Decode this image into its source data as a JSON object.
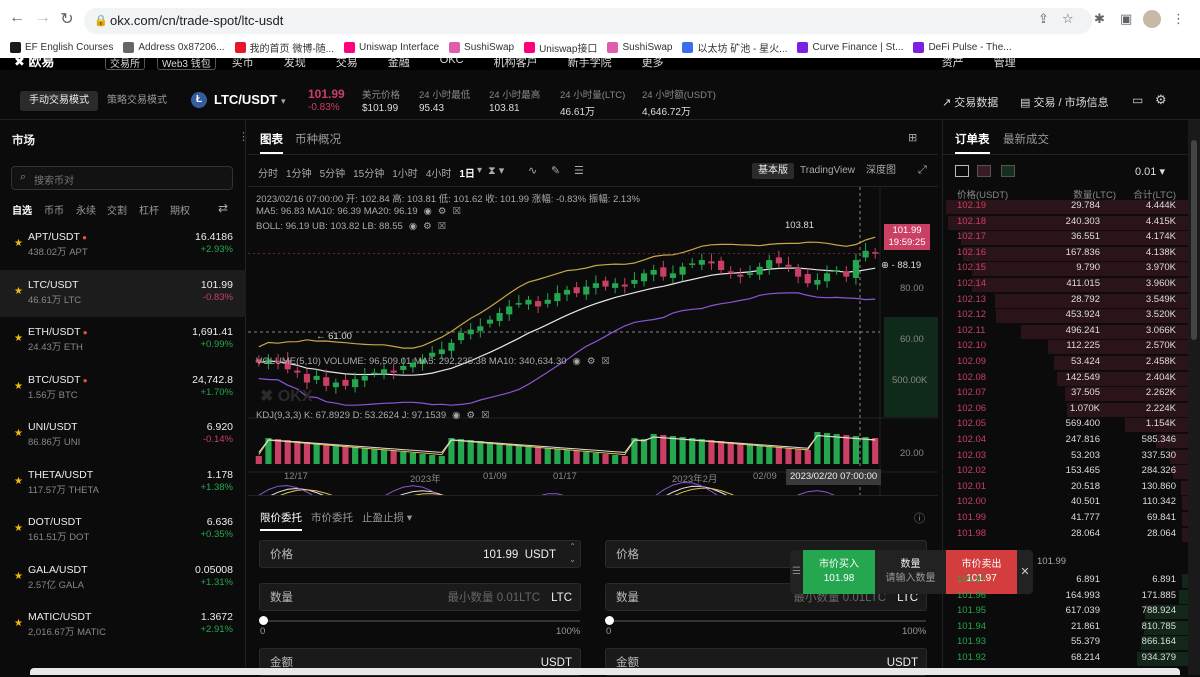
{
  "browser": {
    "url": "okx.com/cn/trade-spot/ltc-usdt",
    "bookmarks": [
      {
        "label": "EF English Courses",
        "color": "#1a1a1a"
      },
      {
        "label": "Address 0x87206...",
        "color": "#666"
      },
      {
        "label": "我的首页 微博-随...",
        "color": "#e6162d"
      },
      {
        "label": "Uniswap Interface",
        "color": "#ff007a"
      },
      {
        "label": "SushiSwap",
        "color": "#e05dab"
      },
      {
        "label": "Uniswap接口",
        "color": "#ff007a"
      },
      {
        "label": "SushiSwap",
        "color": "#e05dab"
      },
      {
        "label": "以太坊 矿池 - 星火...",
        "color": "#3a6df0"
      },
      {
        "label": "Curve Finance | St...",
        "color": "#7b1fe0"
      },
      {
        "label": "DeFi Pulse - The...",
        "color": "#7b1fe0"
      }
    ]
  },
  "topnav": {
    "items": [
      "交易所",
      "Web3 钱包",
      "买币",
      "发现",
      "交易",
      "金融",
      "OKC",
      "机构客户",
      "新手学院",
      "更多",
      "资产",
      "管理"
    ]
  },
  "ticker": {
    "mode_manual": "手动交易模式",
    "mode_strategy": "策略交易模式",
    "pair": "LTC/USDT",
    "price": "101.99",
    "change": "-0.83%",
    "stats": [
      {
        "label": "美元价格",
        "value": "$101.99"
      },
      {
        "label": "24 小时最低",
        "value": "95.43"
      },
      {
        "label": "24 小时最高",
        "value": "103.81"
      },
      {
        "label": "24 小时量(LTC)",
        "value": "46.61万"
      },
      {
        "label": "24 小时额(USDT)",
        "value": "4,646.72万"
      }
    ],
    "trade_data": "交易数据",
    "trade_info": "交易 / 市场信息"
  },
  "market": {
    "title": "市场",
    "search_placeholder": "搜索币对",
    "tabs": [
      "自选",
      "币币",
      "永续",
      "交割",
      "杠杆",
      "期权"
    ],
    "rows": [
      {
        "pair": "APT/USDT",
        "vol": "438.02万 APT",
        "price": "16.4186",
        "change": "+2.93%",
        "dir": "up",
        "fire": true
      },
      {
        "pair": "LTC/USDT",
        "vol": "46.61万 LTC",
        "price": "101.99",
        "change": "-0.83%",
        "dir": "down",
        "fire": false
      },
      {
        "pair": "ETH/USDT",
        "vol": "24.43万 ETH",
        "price": "1,691.41",
        "change": "+0.99%",
        "dir": "up",
        "fire": true
      },
      {
        "pair": "BTC/USDT",
        "vol": "1.56万 BTC",
        "price": "24,742.8",
        "change": "+1.70%",
        "dir": "up",
        "fire": true
      },
      {
        "pair": "UNI/USDT",
        "vol": "86.86万 UNI",
        "price": "6.920",
        "change": "-0.14%",
        "dir": "down",
        "fire": false
      },
      {
        "pair": "THETA/USDT",
        "vol": "117.57万 THETA",
        "price": "1.178",
        "change": "+1.38%",
        "dir": "up",
        "fire": false
      },
      {
        "pair": "DOT/USDT",
        "vol": "161.51万 DOT",
        "price": "6.636",
        "change": "+0.35%",
        "dir": "up",
        "fire": false
      },
      {
        "pair": "GALA/USDT",
        "vol": "2.57亿 GALA",
        "price": "0.05008",
        "change": "+1.31%",
        "dir": "up",
        "fire": false
      },
      {
        "pair": "MATIC/USDT",
        "vol": "2,016.67万 MATIC",
        "price": "1.3672",
        "change": "+2.91%",
        "dir": "up",
        "fire": false
      }
    ]
  },
  "chart": {
    "tab_chart": "图表",
    "tab_overview": "币种概况",
    "intervals": [
      "分时",
      "1分钟",
      "5分钟",
      "15分钟",
      "1小时",
      "4小时",
      "1日"
    ],
    "active_interval": "1日",
    "view_basic": "基本版",
    "view_tv": "TradingView",
    "view_depth": "深度图",
    "ohlc_line": "2023/02/16 07:00:00  开: 102.84  高: 103.81  低: 101.62  收: 101.99  涨幅: -0.83%  振幅: 2.13%",
    "ma_line": "MA5: 96.83  MA10: 96.39  MA20: 96.19",
    "boll_line": "BOLL: 96.19  UB: 103.82  LB: 88.55",
    "vol_line": "VOLUME(5,10)  VOLUME: 96,509.01  MA5: 292,235.38  MA10: 340,634.30",
    "kdj_line": "KDJ(9,3,3)  K: 67.8929  D: 53.2624  J: 97.1539",
    "price_tag": "101.99",
    "countdown": "19:59:25",
    "crosshair_price": "88.19",
    "high_label": "103.81",
    "low_label": "61.00",
    "y_ticks": [
      "80.00",
      "60.00"
    ],
    "vol_tick": "500.00K",
    "kdj_tick": "20.00",
    "x_ticks": [
      "12/17",
      "2023年",
      "01/09",
      "01/17",
      "2023年2月",
      "02/09"
    ],
    "crosshair_time": "2023/02/20 07:00:00"
  },
  "chart_data": {
    "type": "candlestick",
    "title": "LTC/USDT 1日",
    "ylim": [
      55,
      110
    ],
    "close": [
      69,
      70,
      69,
      67,
      66,
      63,
      65,
      62,
      63,
      62,
      64,
      65,
      66,
      67,
      66,
      68,
      69,
      70,
      72,
      73,
      75,
      78,
      79,
      80,
      82,
      84,
      86,
      87,
      88,
      86,
      88,
      90,
      91,
      90,
      92,
      93,
      92,
      93,
      92,
      94,
      96,
      97,
      95,
      96,
      98,
      99,
      100,
      99,
      97,
      96,
      95,
      96,
      98,
      100,
      99,
      98,
      95,
      93,
      94,
      96,
      97,
      95,
      100,
      102.8,
      101.99
    ],
    "volume_ma_label": "VOLUME(5,10)"
  },
  "trade": {
    "tabs": [
      "限价委托",
      "市价委托",
      "止盈止损"
    ],
    "price_label": "价格",
    "price_value": "101.99",
    "unit_usdt": "USDT",
    "qty_label": "数量",
    "qty_placeholder": "最小数量 0.01LTC",
    "unit_ltc": "LTC",
    "slider_min": "0",
    "slider_max": "100%",
    "amount_label": "金额"
  },
  "popup": {
    "buy": "市价买入",
    "buy_price": "101.98",
    "qty": "数量",
    "qty_hint": "请输入数量",
    "sell": "市价卖出",
    "sell_price": "101.97"
  },
  "orderbook": {
    "tab_book": "订单表",
    "tab_trades": "最新成交",
    "precision": "0.01",
    "headers": [
      "价格(USDT)",
      "数量(LTC)",
      "合计(LTC)"
    ],
    "asks": [
      [
        "102.19",
        "29.784",
        "4.444K"
      ],
      [
        "102.18",
        "240.303",
        "4.415K"
      ],
      [
        "102.17",
        "36.551",
        "4.174K"
      ],
      [
        "102.16",
        "167.836",
        "4.138K"
      ],
      [
        "102.15",
        "9.790",
        "3.970K"
      ],
      [
        "102.14",
        "411.015",
        "3.960K"
      ],
      [
        "102.13",
        "28.792",
        "3.549K"
      ],
      [
        "102.12",
        "453.924",
        "3.520K"
      ],
      [
        "102.11",
        "496.241",
        "3.066K"
      ],
      [
        "102.10",
        "112.225",
        "2.570K"
      ],
      [
        "102.09",
        "53.424",
        "2.458K"
      ],
      [
        "102.08",
        "142.549",
        "2.404K"
      ],
      [
        "102.07",
        "37.505",
        "2.262K"
      ],
      [
        "102.06",
        "1.070K",
        "2.224K"
      ],
      [
        "102.05",
        "569.400",
        "1.154K"
      ],
      [
        "102.04",
        "247.816",
        "585.346"
      ],
      [
        "102.03",
        "53.203",
        "337.530"
      ],
      [
        "102.02",
        "153.465",
        "284.326"
      ],
      [
        "102.01",
        "20.518",
        "130.860"
      ],
      [
        "102.00",
        "40.501",
        "110.342"
      ],
      [
        "101.99",
        "41.777",
        "69.841"
      ],
      [
        "101.98",
        "28.064",
        "28.064"
      ]
    ],
    "mid_price": "101.99",
    "bids": [
      [
        "101.97",
        "6.891",
        "6.891"
      ],
      [
        "101.96",
        "164.993",
        "171.885"
      ],
      [
        "101.95",
        "617.039",
        "788.924"
      ],
      [
        "101.94",
        "21.861",
        "810.785"
      ],
      [
        "101.93",
        "55.379",
        "866.164"
      ],
      [
        "101.92",
        "68.214",
        "934.379"
      ]
    ]
  }
}
